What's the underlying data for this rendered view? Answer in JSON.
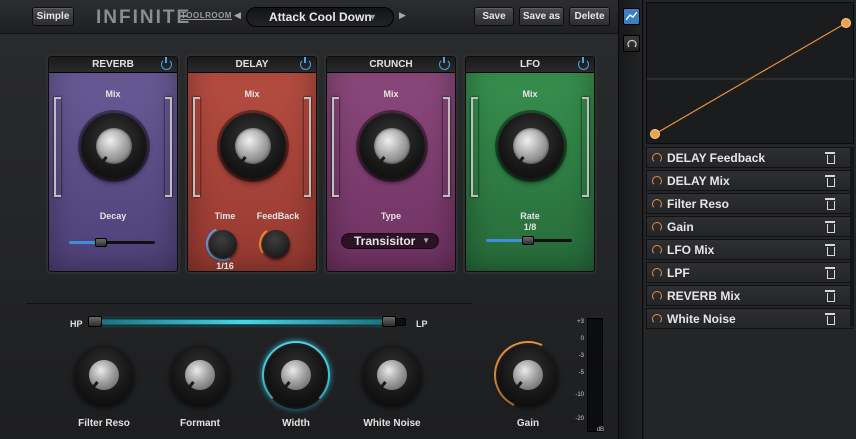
{
  "topbar": {
    "simple_label": "Simple",
    "brand": "INFINITE",
    "brand_sub": "TOOLROOM",
    "prev_arrow": "◀",
    "next_arrow": "▶",
    "preset_name": "Attack Cool Down",
    "preset_caret": "▼",
    "save_label": "Save",
    "save_as_label": "Save as",
    "delete_label": "Delete"
  },
  "modules": {
    "reverb": {
      "title": "REVERB",
      "mix_label": "Mix",
      "decay_label": "Decay",
      "color": "#5a4d86",
      "decay_level": 0.3
    },
    "delay": {
      "title": "DELAY",
      "mix_label": "Mix",
      "time_label": "Time",
      "time_value": "1/16",
      "feedback_label": "FeedBack",
      "color": "#a8463b"
    },
    "crunch": {
      "title": "CRUNCH",
      "mix_label": "Mix",
      "type_label": "Type",
      "type_value": "Transisitor",
      "caret": "▼",
      "color": "#7e3d6e"
    },
    "lfo": {
      "title": "LFO",
      "mix_label": "Mix",
      "rate_label": "Rate",
      "rate_value": "1/8",
      "color": "#2f7f48",
      "rate_level": 0.45
    }
  },
  "filter": {
    "hp_label": "HP",
    "lp_label": "LP",
    "knobs": [
      "Filter Reso",
      "Formant",
      "Width",
      "White Noise"
    ]
  },
  "gain": {
    "label": "Gain",
    "meter_ticks": [
      "+3",
      "0",
      "-3",
      "-5",
      "-10",
      "-20",
      "dB"
    ]
  },
  "automation_list": [
    "DELAY Feedback",
    "DELAY Mix",
    "Filter Reso",
    "Gain",
    "LFO Mix",
    "LPF",
    "REVERB Mix",
    "White Noise"
  ],
  "colors": {
    "accent_blue": "#3f8ed8",
    "accent_orange": "#e8913a",
    "accent_cyan": "#4ad6e6"
  },
  "icons": {
    "graph": "curve-graph-icon",
    "dial": "dial-icon",
    "trash": "trash-icon",
    "power": "power-icon"
  }
}
